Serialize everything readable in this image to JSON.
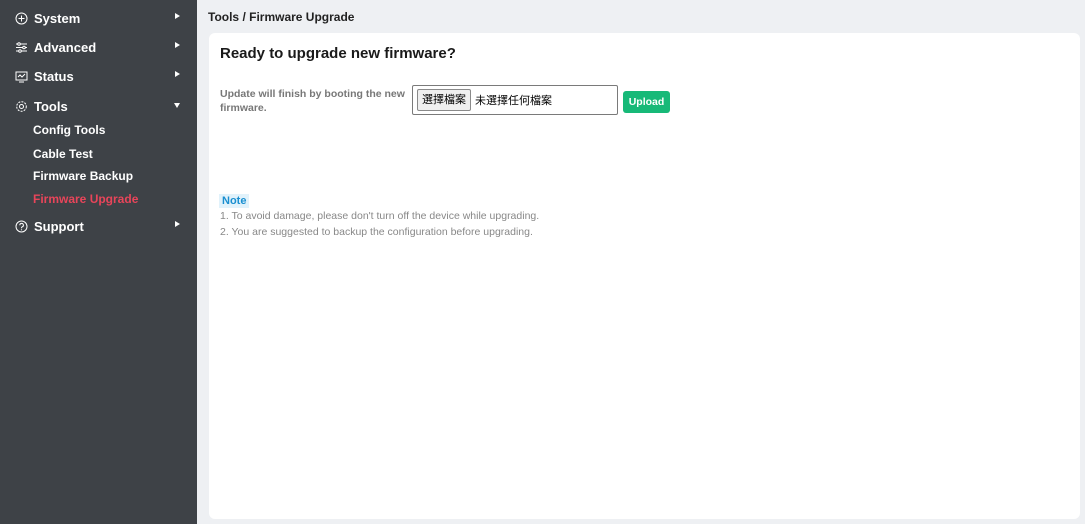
{
  "sidebar": {
    "items": [
      {
        "label": "System",
        "icon": "shield-plus-icon",
        "expanded": false
      },
      {
        "label": "Advanced",
        "icon": "sliders-icon",
        "expanded": false
      },
      {
        "label": "Status",
        "icon": "monitor-icon",
        "expanded": false
      },
      {
        "label": "Tools",
        "icon": "gear-icon",
        "expanded": true
      },
      {
        "label": "Support",
        "icon": "help-circle-icon",
        "expanded": false
      }
    ],
    "tools_subitems": [
      "Config Tools",
      "Cable Test",
      "Firmware Backup",
      "Firmware Upgrade"
    ],
    "active_subitem": "Firmware Upgrade"
  },
  "breadcrumb": "Tools / Firmware Upgrade",
  "panel": {
    "title": "Ready to upgrade new firmware?",
    "field_label": "Update will finish by booting the new firmware.",
    "file_button": "選擇檔案",
    "file_status": "未選擇任何檔案",
    "upload_label": "Upload"
  },
  "note": {
    "tag": "Note",
    "lines": [
      "1. To avoid damage, please don't turn off the device while upgrading.",
      "2. You are suggested to backup the configuration before upgrading."
    ]
  },
  "colors": {
    "sidebar_bg": "#3e4247",
    "active_text": "#e8455a",
    "upload_button": "#17b978",
    "note_tag_bg": "#e1f2fb",
    "note_tag_text": "#1a8fd0"
  }
}
